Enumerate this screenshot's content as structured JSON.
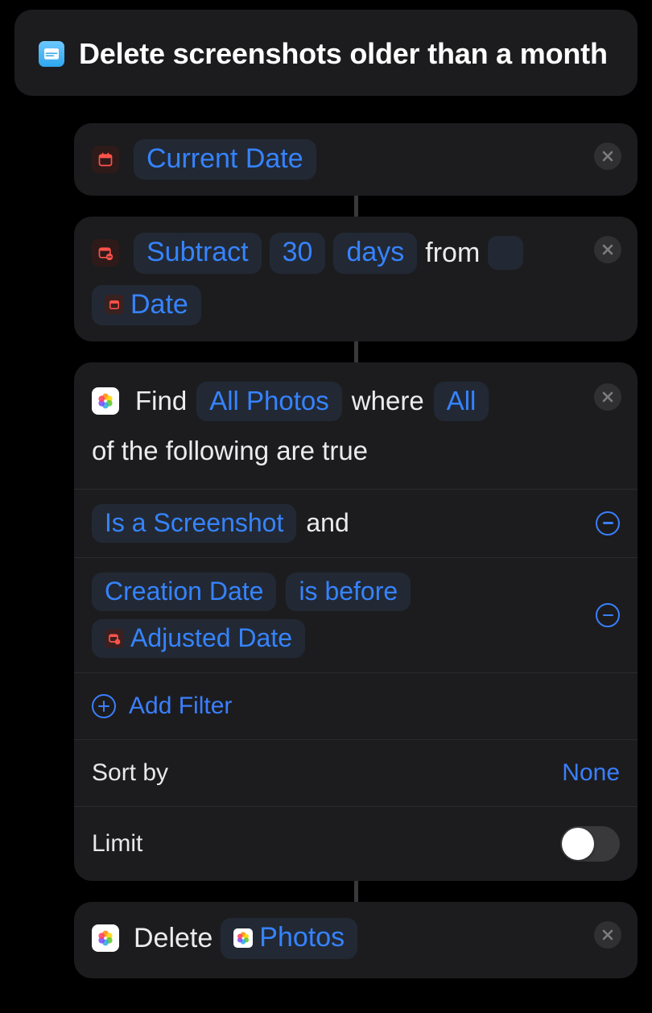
{
  "header": {
    "title": "Delete screenshots older than a month"
  },
  "actions": {
    "current_date": {
      "label": "Current Date"
    },
    "subtract": {
      "operation": "Subtract",
      "amount": "30",
      "unit": "days",
      "from_word": "from",
      "source_var": "Date"
    },
    "find": {
      "verb": "Find",
      "scope": "All Photos",
      "where_word": "where",
      "combinator": "All",
      "tail": "of the following are true",
      "filters": [
        {
          "field": "Is a Screenshot",
          "join": "and"
        },
        {
          "field": "Creation Date",
          "operator": "is before",
          "value": "Adjusted Date"
        }
      ],
      "add_filter_label": "Add Filter",
      "sort_by_label": "Sort by",
      "sort_by_value": "None",
      "limit_label": "Limit",
      "limit_on": false
    },
    "delete": {
      "verb": "Delete",
      "target": "Photos"
    }
  }
}
